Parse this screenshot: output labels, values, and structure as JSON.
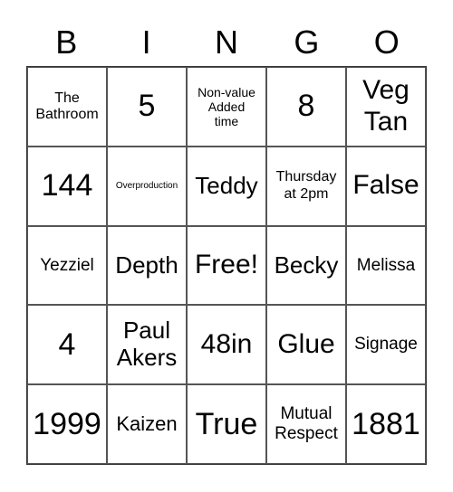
{
  "header": [
    "B",
    "I",
    "N",
    "G",
    "O"
  ],
  "cells": [
    {
      "text": "The\nBathroom",
      "size": "s-xs"
    },
    {
      "text": "5",
      "size": "s-xl"
    },
    {
      "text": "Non-value\nAdded\ntime",
      "size": "s-xxs"
    },
    {
      "text": "8",
      "size": "s-xl"
    },
    {
      "text": "Veg\nTan",
      "size": "s-lg"
    },
    {
      "text": "144",
      "size": "s-xl"
    },
    {
      "text": "Overproduction",
      "size": "s-tiny"
    },
    {
      "text": "Teddy",
      "size": "s-ml"
    },
    {
      "text": "Thursday\nat 2pm",
      "size": "s-xs"
    },
    {
      "text": "False",
      "size": "s-lg"
    },
    {
      "text": "Yezziel",
      "size": "s-sm"
    },
    {
      "text": "Depth",
      "size": "s-ml"
    },
    {
      "text": "Free!",
      "size": "s-lg"
    },
    {
      "text": "Becky",
      "size": "s-ml"
    },
    {
      "text": "Melissa",
      "size": "s-sm"
    },
    {
      "text": "4",
      "size": "s-xl"
    },
    {
      "text": "Paul\nAkers",
      "size": "s-ml"
    },
    {
      "text": "48in",
      "size": "s-lg"
    },
    {
      "text": "Glue",
      "size": "s-lg"
    },
    {
      "text": "Signage",
      "size": "s-sm"
    },
    {
      "text": "1999",
      "size": "s-xl"
    },
    {
      "text": "Kaizen",
      "size": "s-md"
    },
    {
      "text": "True",
      "size": "s-xl"
    },
    {
      "text": "Mutual\nRespect",
      "size": "s-sm"
    },
    {
      "text": "1881",
      "size": "s-xl"
    }
  ]
}
